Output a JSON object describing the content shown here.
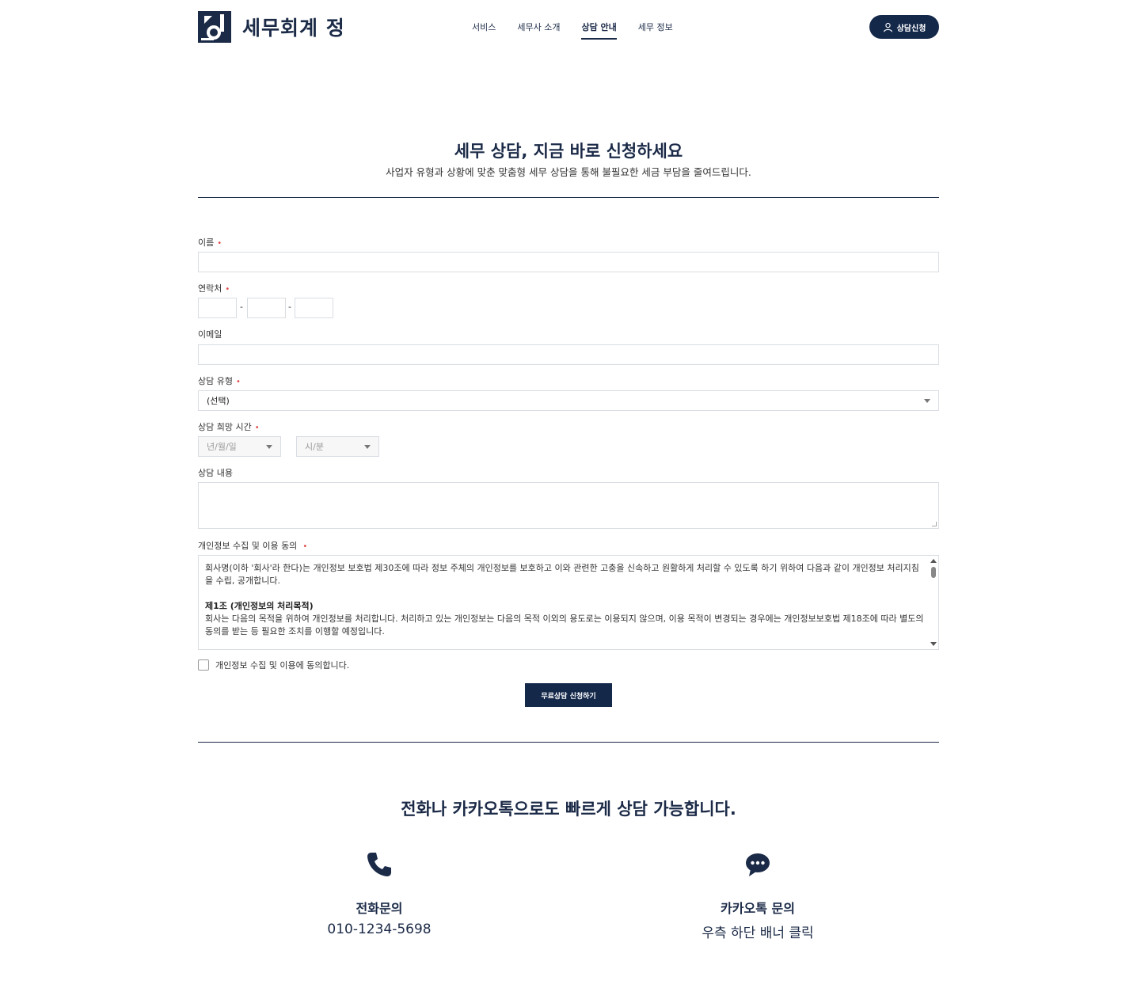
{
  "header": {
    "logo_text": "세무회계 정",
    "nav": [
      {
        "label": "서비스",
        "active": false
      },
      {
        "label": "세무사 소개",
        "active": false
      },
      {
        "label": "상담 안내",
        "active": true
      },
      {
        "label": "세무 정보",
        "active": false
      }
    ],
    "cta_label": "상담신청",
    "cta_icon": "user-icon"
  },
  "hero": {
    "title": "세무 상담, 지금 바로 신청하세요",
    "subtitle": "사업자 유형과 상황에 맞춘 맞춤형 세무 상담을 통해 불필요한 세금 부담을 줄여드립니다."
  },
  "form": {
    "name_label": "이름",
    "phone_label": "연락처",
    "phone_separator": "-",
    "email_label": "이메일",
    "type_label": "상담 유형",
    "type_selected": "(선택)",
    "time_label": "상담 희망 시간",
    "date_placeholder": "년/월/일",
    "time_placeholder": "시/분",
    "content_label": "상담 내용",
    "privacy_label": "개인정보 수집 및 이용 동의",
    "required_mark": "•",
    "privacy_text": {
      "intro": "회사명(이하 '회사'라 한다)는 개인정보 보호법 제30조에 따라 정보 주체의 개인정보를 보호하고 이와 관련한 고충을 신속하고 원활하게 처리할 수 있도록 하기 위하여 다음과 같이 개인정보 처리지침을 수립, 공개합니다.",
      "section1_title": "제1조 (개인정보의 처리목적)",
      "section1_body": "회사는 다음의 목적을 위하여 개인정보를 처리합니다. 처리하고 있는 개인정보는 다음의 목적 이외의 용도로는 이용되지 않으며, 이용 목적이 변경되는 경우에는 개인정보보호법 제18조에 따라 별도의 동의를 받는 등 필요한 조치를 이행할 예정입니다."
    },
    "agree_label": "개인정보 수집 및 이용에 동의합니다.",
    "agree_checked": false,
    "submit_label": "무료상담 신청하기"
  },
  "contact": {
    "title": "전화나 카카오톡으로도 빠르게 상담 가능합니다.",
    "phone": {
      "icon": "phone-icon",
      "heading": "전화문의",
      "value": "010-1234-5698"
    },
    "kakao": {
      "icon": "chat-bubble-icon",
      "heading": "카카오톡 문의",
      "value": "우측 하단 배너 클릭"
    }
  },
  "colors": {
    "brand": "#14284a",
    "required": "#e04a4a",
    "border": "#d9dde3"
  }
}
